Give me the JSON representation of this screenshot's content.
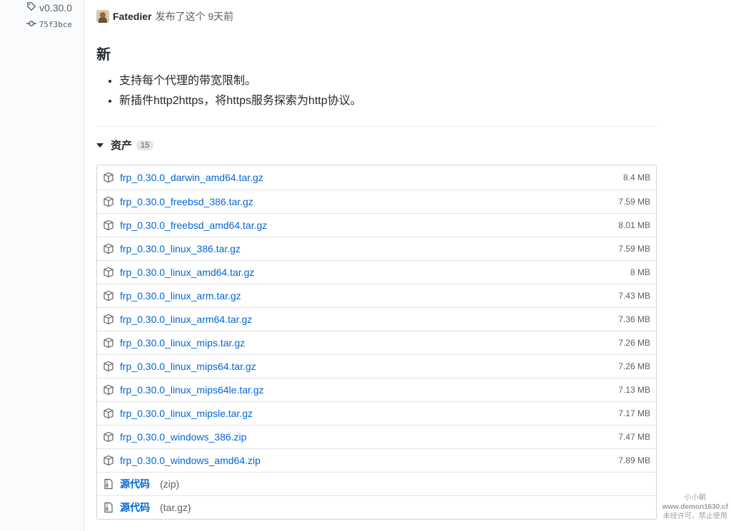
{
  "sidebar": {
    "tag": "v0.30.0",
    "commit": "75f3bce"
  },
  "release": {
    "author": "Fatedier",
    "published_text": "发布了这个 9天前",
    "title": "新",
    "notes": [
      "支持每个代理的带宽限制。",
      "新插件http2https，将https服务探索为http协议。"
    ]
  },
  "assets": {
    "heading": "资产",
    "count": "15",
    "files": [
      {
        "name": "frp_0.30.0_darwin_amd64.tar.gz",
        "size": "8.4 MB"
      },
      {
        "name": "frp_0.30.0_freebsd_386.tar.gz",
        "size": "7.59 MB"
      },
      {
        "name": "frp_0.30.0_freebsd_amd64.tar.gz",
        "size": "8.01 MB"
      },
      {
        "name": "frp_0.30.0_linux_386.tar.gz",
        "size": "7.59 MB"
      },
      {
        "name": "frp_0.30.0_linux_amd64.tar.gz",
        "size": "8 MB"
      },
      {
        "name": "frp_0.30.0_linux_arm.tar.gz",
        "size": "7.43 MB"
      },
      {
        "name": "frp_0.30.0_linux_arm64.tar.gz",
        "size": "7.36 MB"
      },
      {
        "name": "frp_0.30.0_linux_mips.tar.gz",
        "size": "7.26 MB"
      },
      {
        "name": "frp_0.30.0_linux_mips64.tar.gz",
        "size": "7.26 MB"
      },
      {
        "name": "frp_0.30.0_linux_mips64le.tar.gz",
        "size": "7.13 MB"
      },
      {
        "name": "frp_0.30.0_linux_mipsle.tar.gz",
        "size": "7.17 MB"
      },
      {
        "name": "frp_0.30.0_windows_386.zip",
        "size": "7.47 MB"
      },
      {
        "name": "frp_0.30.0_windows_amd64.zip",
        "size": "7.89 MB"
      }
    ],
    "source": [
      {
        "label": "源代码",
        "format": "(zip)"
      },
      {
        "label": "源代码",
        "format": "(tar.gz)"
      }
    ]
  },
  "watermark": {
    "line1": "小小朝",
    "line2": "www.demon1630.cf",
    "line3": "未经许可，禁止使用"
  },
  "colors": {
    "link": "#0366d6",
    "muted": "#586069",
    "border": "#d1d5da"
  },
  "icons": {
    "tag": "tag-icon",
    "commit": "git-commit-icon",
    "package": "package-icon",
    "zip": "file-zip-icon",
    "caret": "triangle-down-icon"
  }
}
